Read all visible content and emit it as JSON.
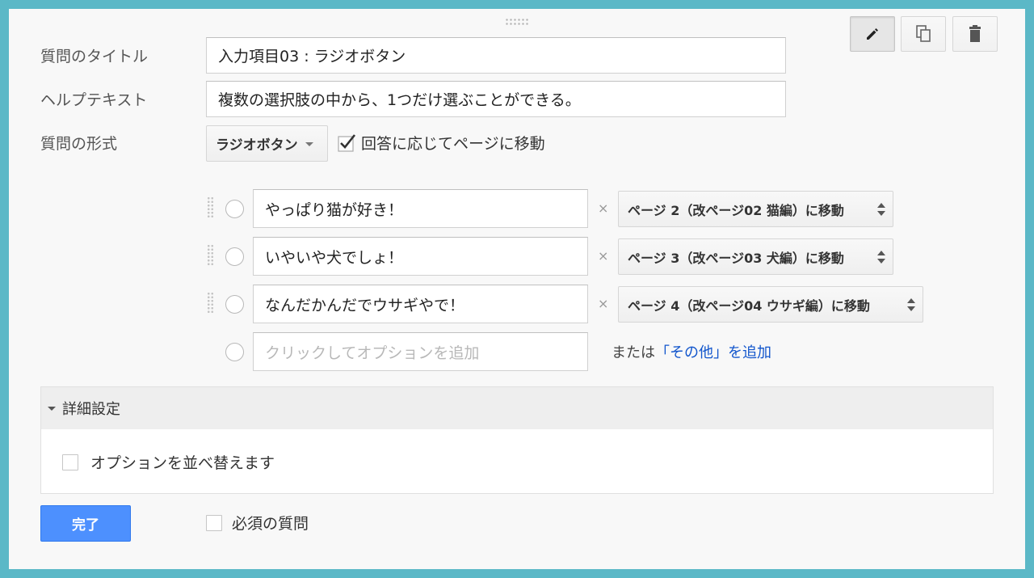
{
  "toolbar": {
    "edit_icon": "pencil-icon",
    "duplicate_icon": "duplicate-icon",
    "delete_icon": "trash-icon"
  },
  "form": {
    "title_label": "質問のタイトル",
    "title_value": "入力項目03 : ラジオボタン",
    "help_label": "ヘルプテキスト",
    "help_value": "複数の選択肢の中から、1つだけ選ぶことができる。",
    "type_label": "質問の形式",
    "type_value": "ラジオボタン",
    "goto_page_label": "回答に応じてページに移動",
    "goto_page_checked": true
  },
  "options": [
    {
      "text": "やっぱり猫が好き！",
      "goto": "ページ 2（改ページ02 猫編）に移動"
    },
    {
      "text": "いやいや犬でしょ！",
      "goto": "ページ 3（改ページ03 犬編）に移動"
    },
    {
      "text": "なんだかんだでウサギやで！",
      "goto": "ページ 4（改ページ04 ウサギ編）に移動"
    }
  ],
  "remove_symbol": "×",
  "add_option": {
    "placeholder": "クリックしてオプションを追加",
    "or_text": "または",
    "other_link": "「その他」を追加"
  },
  "advanced": {
    "header": "詳細設定",
    "shuffle_label": "オプションを並べ替えます",
    "shuffle_checked": false
  },
  "footer": {
    "done_label": "完了",
    "required_label": "必須の質問",
    "required_checked": false
  },
  "colors": {
    "frame": "#5bb8c7",
    "primary_button": "#4d90fe",
    "link": "#1155cc"
  }
}
